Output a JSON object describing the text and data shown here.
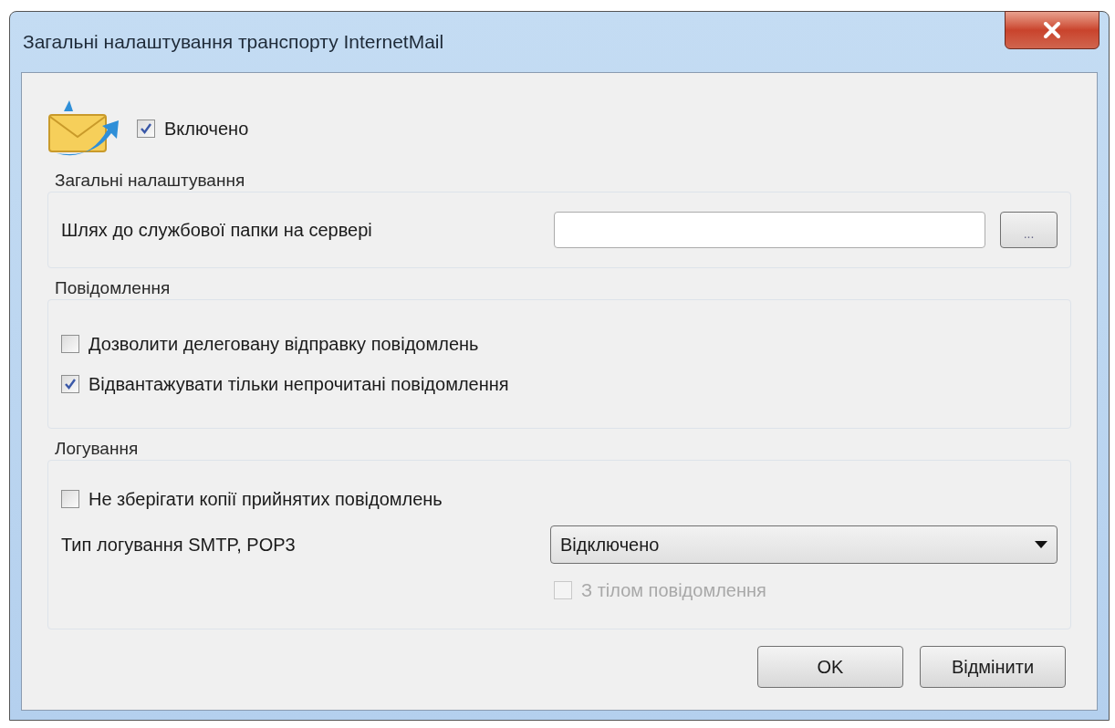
{
  "window": {
    "title": "Загальні налаштування транспорту InternetMail"
  },
  "enabled": {
    "label": "Включено",
    "checked": true
  },
  "sections": [
    {
      "title": "Загальні налаштування",
      "items": [
        {
          "kind": "path",
          "label": "Шлях до службової папки на сервері",
          "browse": "..."
        }
      ]
    },
    {
      "title": "Повідомлення",
      "items": [
        {
          "kind": "checkbox",
          "label": "Дозволити делеговану відправку повідомлень",
          "checked": false,
          "disabled": false
        },
        {
          "kind": "checkbox",
          "label": "Відвантажувати тільки непрочитані повідомлення",
          "checked": true,
          "disabled": false
        }
      ]
    },
    {
      "title": "Логування",
      "items": [
        {
          "kind": "checkbox",
          "label": "Не зберігати копії прийнятих повідомлень",
          "checked": false,
          "disabled": false
        },
        {
          "kind": "combo",
          "label": "Тип логування SMTP, POP3",
          "value": "Відключено"
        },
        {
          "kind": "checkbox",
          "label": "З тілом повідомлення",
          "checked": false,
          "disabled": true,
          "indent": true
        }
      ]
    }
  ],
  "buttons": [
    "OK",
    "Відмінити"
  ]
}
